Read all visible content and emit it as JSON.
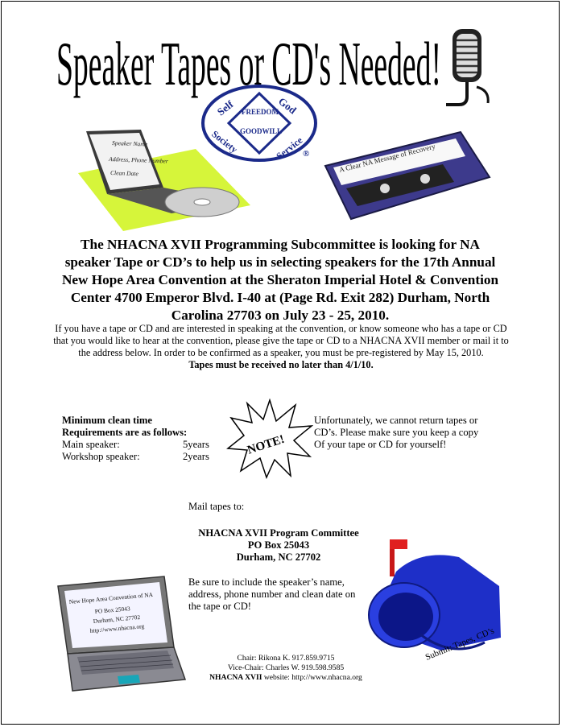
{
  "headline": "Speaker Tapes or CD's Needed!",
  "logo": {
    "top_left": "Self",
    "top_right": "God",
    "center_top": "FREEDOM",
    "center_bottom": "GOODWILL",
    "bottom_left": "Society",
    "bottom_right": "Service",
    "mark": "®"
  },
  "cd_case": {
    "line1": "Speaker Name",
    "line2": "Address, Phone Number",
    "line3": "Clean Date"
  },
  "cassette_label": "A Clear NA Message of Recovery",
  "lead_paragraph": "The NHACNA XVII Programming Subcommittee is looking for NA speaker Tape or CD’s to help us in selecting speakers for the 17th Annual New Hope Area Convention  at the Sheraton Imperial Hotel & Convention Center 4700 Emperor Blvd. I-40 at (Page Rd. Exit 282) Durham, North Carolina 27703 on July 23 - 25, 2010.",
  "body_paragraph": "If you have a tape or CD and are interested in speaking at the convention, or know someone who has a tape or CD that you would like to hear at the convention, please give the tape or CD to a NHACNA XVII member or mail it to the address below. In order to be confirmed as a speaker, you must be pre-registered by May 15, 2010.",
  "deadline": "Tapes must be received no later than 4/1/10.",
  "requirements": {
    "title1": "Minimum clean time",
    "title2": "Requirements are as follows:",
    "rows": [
      {
        "label": "Main speaker:",
        "value": "5years"
      },
      {
        "label": "Workshop speaker:",
        "value": "2years"
      }
    ]
  },
  "note_burst": "NOTE!",
  "note_text": {
    "line1": "Unfortunately, we cannot return tapes or",
    "line2": "CD’s. Please make sure you keep a copy",
    "line3": "Of your tape or CD for yourself!"
  },
  "mail_label": "Mail tapes to:",
  "address": {
    "line1": "NHACNA XVII Program Committee",
    "line2": "PO  Box 25043",
    "line3": "Durham, NC 27702"
  },
  "include_text": "Be sure to include the speaker’s name, address, phone number and clean date on the tape or CD!",
  "laptop_screen": {
    "line1": "New Hope Area Convention of NA",
    "line2": "PO Box 25043",
    "line3": "Durham, NC 27702",
    "line4": "http://www.nhacna.org"
  },
  "mailbox_caption": "Submit: Tapes, CD’s",
  "contacts": {
    "chair": "Chair: Rikona K.  917.859.9715",
    "vice_chair": "Vice-Chair: Charles W. 919.598.9585",
    "website_label": "NHACNA XVII",
    "website": " website: http://www.nhacna.org"
  }
}
